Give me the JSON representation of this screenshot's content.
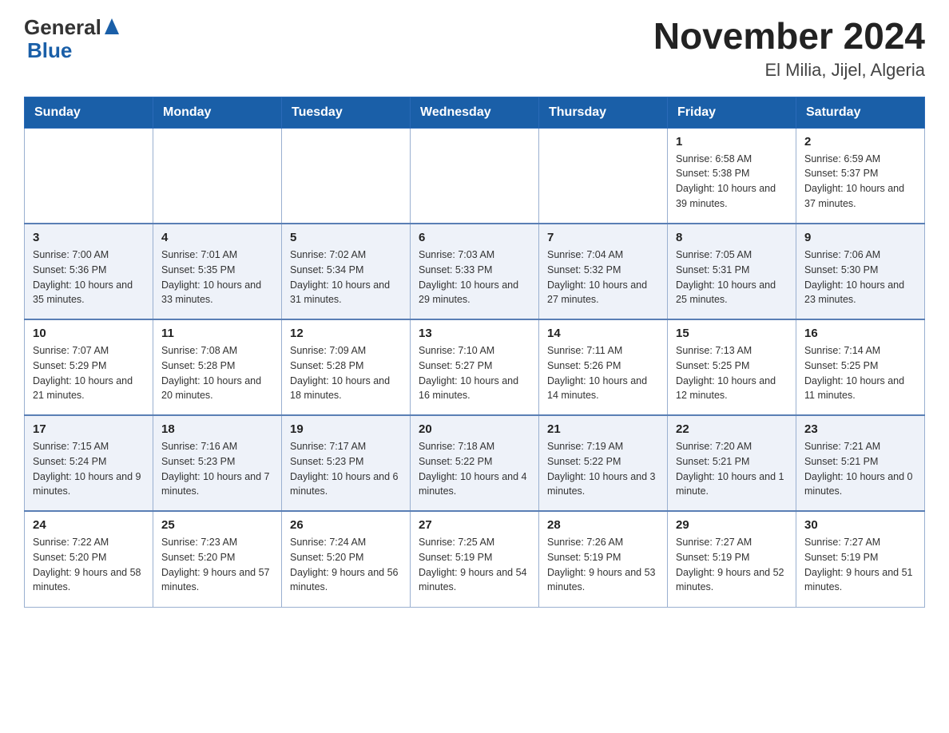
{
  "header": {
    "logo_general": "General",
    "logo_blue": "Blue",
    "title": "November 2024",
    "subtitle": "El Milia, Jijel, Algeria"
  },
  "weekdays": [
    "Sunday",
    "Monday",
    "Tuesday",
    "Wednesday",
    "Thursday",
    "Friday",
    "Saturday"
  ],
  "rows": [
    [
      {
        "day": "",
        "sunrise": "",
        "sunset": "",
        "daylight": ""
      },
      {
        "day": "",
        "sunrise": "",
        "sunset": "",
        "daylight": ""
      },
      {
        "day": "",
        "sunrise": "",
        "sunset": "",
        "daylight": ""
      },
      {
        "day": "",
        "sunrise": "",
        "sunset": "",
        "daylight": ""
      },
      {
        "day": "",
        "sunrise": "",
        "sunset": "",
        "daylight": ""
      },
      {
        "day": "1",
        "sunrise": "Sunrise: 6:58 AM",
        "sunset": "Sunset: 5:38 PM",
        "daylight": "Daylight: 10 hours and 39 minutes."
      },
      {
        "day": "2",
        "sunrise": "Sunrise: 6:59 AM",
        "sunset": "Sunset: 5:37 PM",
        "daylight": "Daylight: 10 hours and 37 minutes."
      }
    ],
    [
      {
        "day": "3",
        "sunrise": "Sunrise: 7:00 AM",
        "sunset": "Sunset: 5:36 PM",
        "daylight": "Daylight: 10 hours and 35 minutes."
      },
      {
        "day": "4",
        "sunrise": "Sunrise: 7:01 AM",
        "sunset": "Sunset: 5:35 PM",
        "daylight": "Daylight: 10 hours and 33 minutes."
      },
      {
        "day": "5",
        "sunrise": "Sunrise: 7:02 AM",
        "sunset": "Sunset: 5:34 PM",
        "daylight": "Daylight: 10 hours and 31 minutes."
      },
      {
        "day": "6",
        "sunrise": "Sunrise: 7:03 AM",
        "sunset": "Sunset: 5:33 PM",
        "daylight": "Daylight: 10 hours and 29 minutes."
      },
      {
        "day": "7",
        "sunrise": "Sunrise: 7:04 AM",
        "sunset": "Sunset: 5:32 PM",
        "daylight": "Daylight: 10 hours and 27 minutes."
      },
      {
        "day": "8",
        "sunrise": "Sunrise: 7:05 AM",
        "sunset": "Sunset: 5:31 PM",
        "daylight": "Daylight: 10 hours and 25 minutes."
      },
      {
        "day": "9",
        "sunrise": "Sunrise: 7:06 AM",
        "sunset": "Sunset: 5:30 PM",
        "daylight": "Daylight: 10 hours and 23 minutes."
      }
    ],
    [
      {
        "day": "10",
        "sunrise": "Sunrise: 7:07 AM",
        "sunset": "Sunset: 5:29 PM",
        "daylight": "Daylight: 10 hours and 21 minutes."
      },
      {
        "day": "11",
        "sunrise": "Sunrise: 7:08 AM",
        "sunset": "Sunset: 5:28 PM",
        "daylight": "Daylight: 10 hours and 20 minutes."
      },
      {
        "day": "12",
        "sunrise": "Sunrise: 7:09 AM",
        "sunset": "Sunset: 5:28 PM",
        "daylight": "Daylight: 10 hours and 18 minutes."
      },
      {
        "day": "13",
        "sunrise": "Sunrise: 7:10 AM",
        "sunset": "Sunset: 5:27 PM",
        "daylight": "Daylight: 10 hours and 16 minutes."
      },
      {
        "day": "14",
        "sunrise": "Sunrise: 7:11 AM",
        "sunset": "Sunset: 5:26 PM",
        "daylight": "Daylight: 10 hours and 14 minutes."
      },
      {
        "day": "15",
        "sunrise": "Sunrise: 7:13 AM",
        "sunset": "Sunset: 5:25 PM",
        "daylight": "Daylight: 10 hours and 12 minutes."
      },
      {
        "day": "16",
        "sunrise": "Sunrise: 7:14 AM",
        "sunset": "Sunset: 5:25 PM",
        "daylight": "Daylight: 10 hours and 11 minutes."
      }
    ],
    [
      {
        "day": "17",
        "sunrise": "Sunrise: 7:15 AM",
        "sunset": "Sunset: 5:24 PM",
        "daylight": "Daylight: 10 hours and 9 minutes."
      },
      {
        "day": "18",
        "sunrise": "Sunrise: 7:16 AM",
        "sunset": "Sunset: 5:23 PM",
        "daylight": "Daylight: 10 hours and 7 minutes."
      },
      {
        "day": "19",
        "sunrise": "Sunrise: 7:17 AM",
        "sunset": "Sunset: 5:23 PM",
        "daylight": "Daylight: 10 hours and 6 minutes."
      },
      {
        "day": "20",
        "sunrise": "Sunrise: 7:18 AM",
        "sunset": "Sunset: 5:22 PM",
        "daylight": "Daylight: 10 hours and 4 minutes."
      },
      {
        "day": "21",
        "sunrise": "Sunrise: 7:19 AM",
        "sunset": "Sunset: 5:22 PM",
        "daylight": "Daylight: 10 hours and 3 minutes."
      },
      {
        "day": "22",
        "sunrise": "Sunrise: 7:20 AM",
        "sunset": "Sunset: 5:21 PM",
        "daylight": "Daylight: 10 hours and 1 minute."
      },
      {
        "day": "23",
        "sunrise": "Sunrise: 7:21 AM",
        "sunset": "Sunset: 5:21 PM",
        "daylight": "Daylight: 10 hours and 0 minutes."
      }
    ],
    [
      {
        "day": "24",
        "sunrise": "Sunrise: 7:22 AM",
        "sunset": "Sunset: 5:20 PM",
        "daylight": "Daylight: 9 hours and 58 minutes."
      },
      {
        "day": "25",
        "sunrise": "Sunrise: 7:23 AM",
        "sunset": "Sunset: 5:20 PM",
        "daylight": "Daylight: 9 hours and 57 minutes."
      },
      {
        "day": "26",
        "sunrise": "Sunrise: 7:24 AM",
        "sunset": "Sunset: 5:20 PM",
        "daylight": "Daylight: 9 hours and 56 minutes."
      },
      {
        "day": "27",
        "sunrise": "Sunrise: 7:25 AM",
        "sunset": "Sunset: 5:19 PM",
        "daylight": "Daylight: 9 hours and 54 minutes."
      },
      {
        "day": "28",
        "sunrise": "Sunrise: 7:26 AM",
        "sunset": "Sunset: 5:19 PM",
        "daylight": "Daylight: 9 hours and 53 minutes."
      },
      {
        "day": "29",
        "sunrise": "Sunrise: 7:27 AM",
        "sunset": "Sunset: 5:19 PM",
        "daylight": "Daylight: 9 hours and 52 minutes."
      },
      {
        "day": "30",
        "sunrise": "Sunrise: 7:27 AM",
        "sunset": "Sunset: 5:19 PM",
        "daylight": "Daylight: 9 hours and 51 minutes."
      }
    ]
  ]
}
